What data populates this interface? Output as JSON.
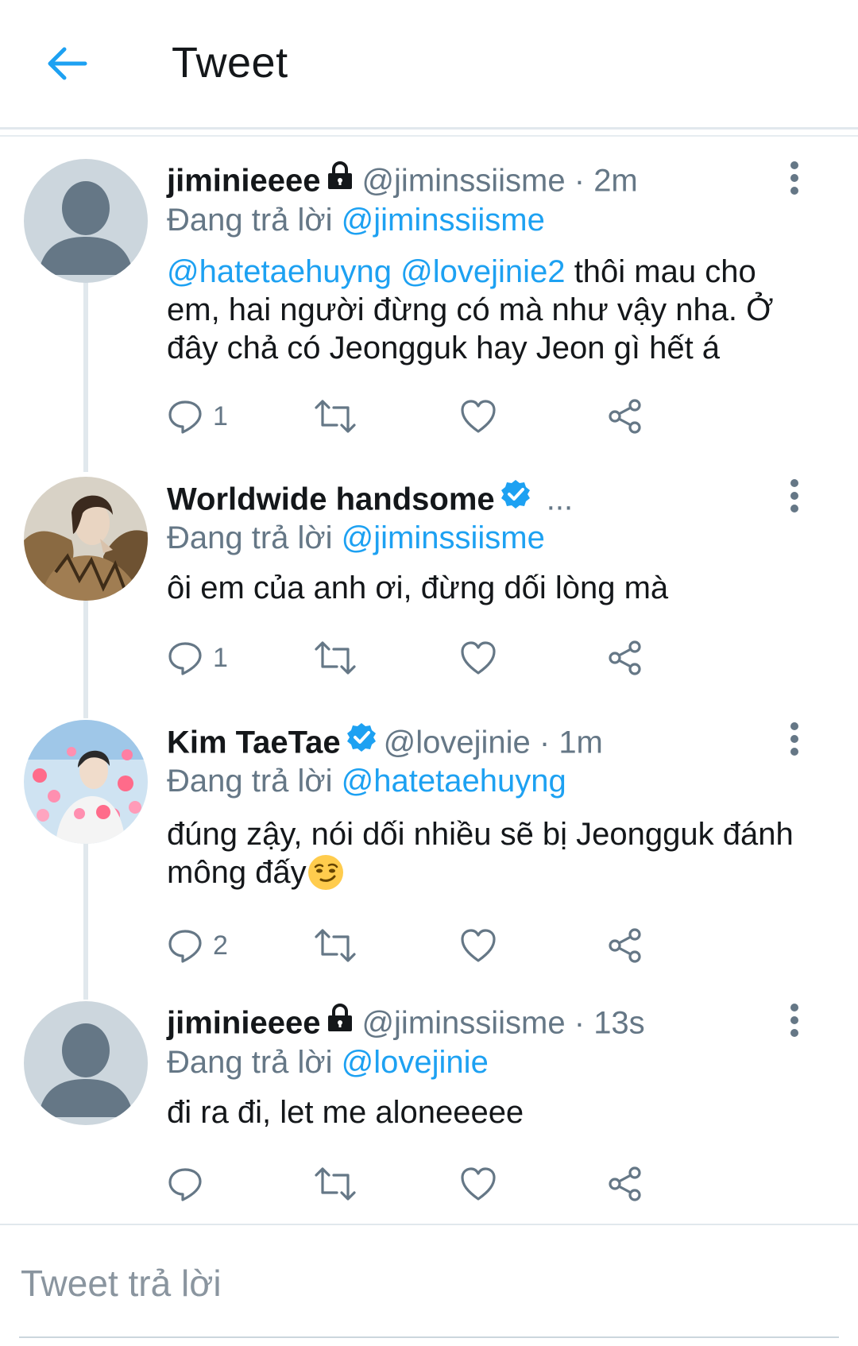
{
  "header": {
    "title": "Tweet"
  },
  "colors": {
    "accent": "#1da1f2",
    "secondary_text": "#657786",
    "divider": "#e1e8ed"
  },
  "tweets": [
    {
      "name": "jiminieeee",
      "locked": true,
      "handle": "@jiminssiisme",
      "sep": "·",
      "time": "2m",
      "reply_prefix": "Đang trả lời",
      "reply_to": "@jiminssiisme",
      "body_mentions": [
        "@hatetaehuyng",
        "@lovejinie2"
      ],
      "body_text": "thôi mau cho em, hai người đừng có mà như vậy nha. Ở đây chả có Jeongguk hay Jeon gì hết á",
      "reply_count": "1"
    },
    {
      "name": "Worldwide handsome",
      "verified": true,
      "truncated": "...",
      "reply_prefix": "Đang trả lời",
      "reply_to": "@jiminssiisme",
      "body_text": "ôi em của anh ơi, đừng dối lòng mà",
      "reply_count": "1"
    },
    {
      "name": "Kim TaeTae",
      "verified": true,
      "handle": "@lovejinie",
      "sep": "·",
      "time": "1m",
      "reply_prefix": "Đang trả lời",
      "reply_to": "@hatetaehuyng",
      "body_text": "đúng zậy, nói dối nhiều sẽ bị Jeongguk đánh mông đấy",
      "emoji": "smirking-face-emoji",
      "reply_count": "2"
    },
    {
      "name": "jiminieeee",
      "locked": true,
      "handle": "@jiminssiisme",
      "sep": "·",
      "time": "13s",
      "reply_prefix": "Đang trả lời",
      "reply_to": "@lovejinie",
      "body_text": "đi ra đi, let me aloneeeee",
      "reply_count": ""
    }
  ],
  "compose": {
    "placeholder": "Tweet trả lời"
  },
  "icons": [
    "back-arrow-icon",
    "lock-icon",
    "verified-badge-icon",
    "more-options-icon",
    "reply-icon",
    "retweet-icon",
    "like-icon",
    "share-icon"
  ]
}
